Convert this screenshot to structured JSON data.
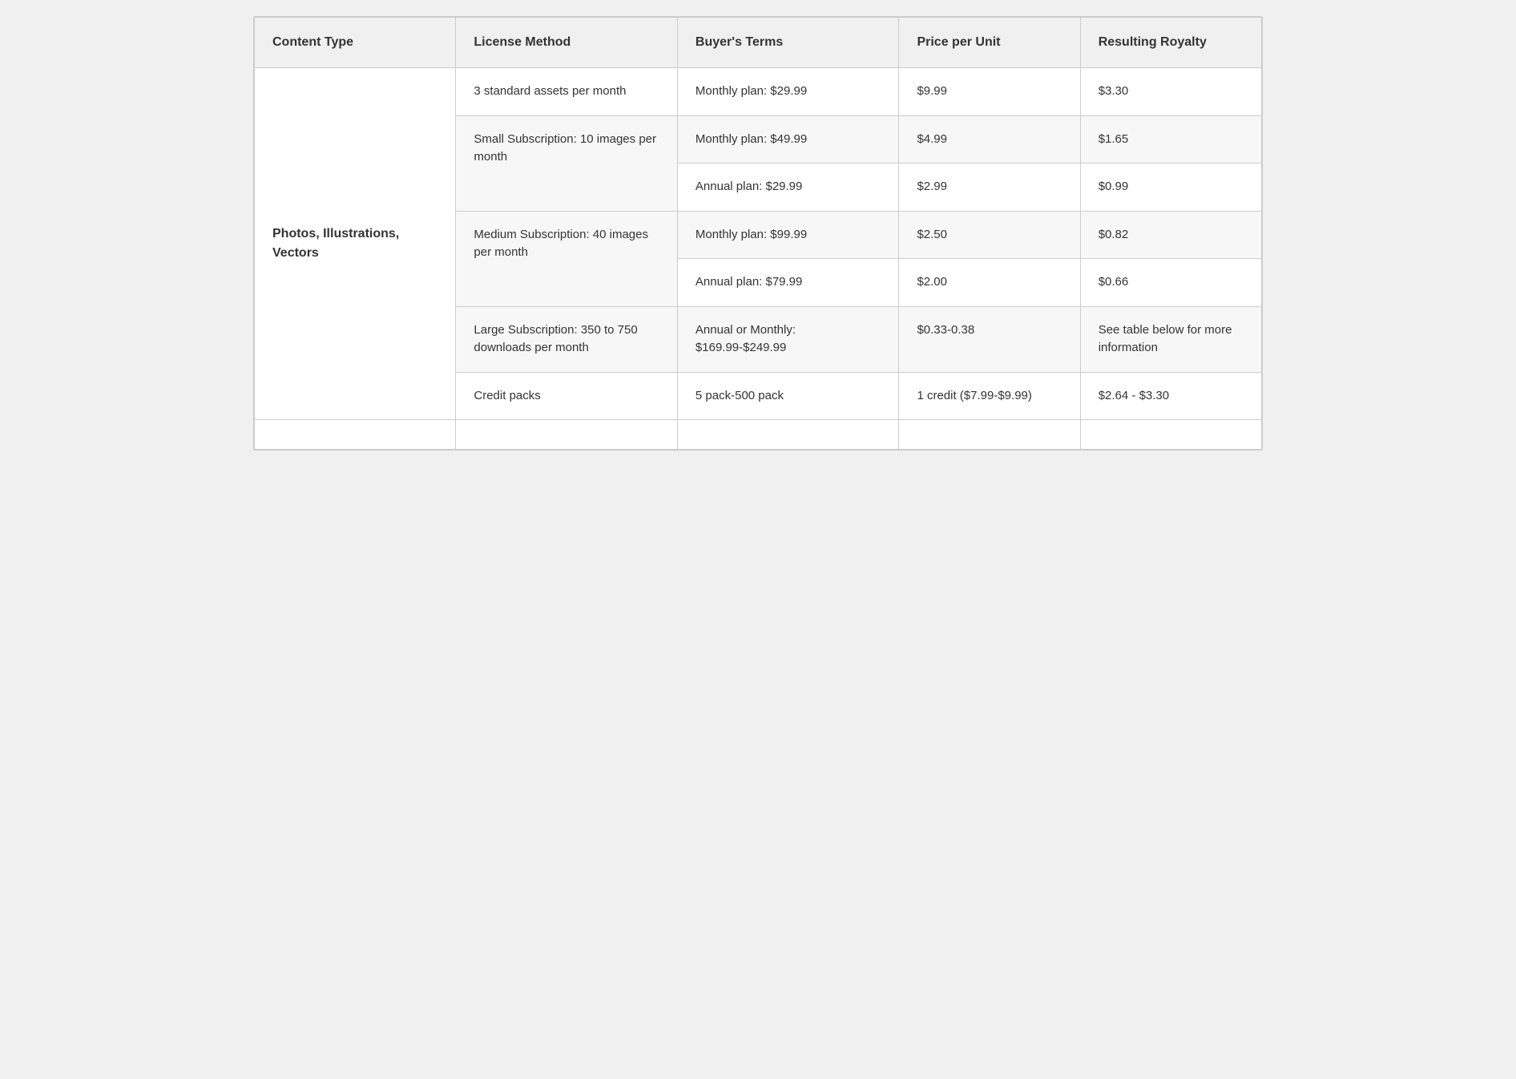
{
  "table": {
    "headers": {
      "content_type": "Content Type",
      "license_method": "License Method",
      "buyers_terms": "Buyer's Terms",
      "price_per_unit": "Price per Unit",
      "resulting_royalty": "Resulting Royalty"
    },
    "sections": [
      {
        "content_type": "Photos, Illustrations, Vectors",
        "rows": [
          {
            "license_method": "3 standard assets per month",
            "buyers_terms": "Monthly plan: $29.99",
            "price_per_unit": "$9.99",
            "resulting_royalty": "$3.30",
            "license_rowspan": 1,
            "shaded": false
          },
          {
            "license_method": "Small Subscription: 10 images per month",
            "buyers_terms": "Monthly plan: $49.99",
            "price_per_unit": "$4.99",
            "resulting_royalty": "$1.65",
            "license_rowspan": 2,
            "shaded": true
          },
          {
            "license_method": null,
            "buyers_terms": "Annual plan: $29.99",
            "price_per_unit": "$2.99",
            "resulting_royalty": "$0.99",
            "license_rowspan": 0,
            "shaded": false
          },
          {
            "license_method": "Medium Subscription: 40 images per month",
            "buyers_terms": "Monthly plan: $99.99",
            "price_per_unit": "$2.50",
            "resulting_royalty": "$0.82",
            "license_rowspan": 2,
            "shaded": true
          },
          {
            "license_method": null,
            "buyers_terms": "Annual plan: $79.99",
            "price_per_unit": "$2.00",
            "resulting_royalty": "$0.66",
            "license_rowspan": 0,
            "shaded": false
          },
          {
            "license_method": "Large Subscription: 350 to 750 downloads per month",
            "buyers_terms": "Annual or Monthly: $169.99-$249.99",
            "price_per_unit": "$0.33-0.38",
            "resulting_royalty": "See table below for more information",
            "license_rowspan": 1,
            "shaded": true
          },
          {
            "license_method": "Credit packs",
            "buyers_terms": "5 pack-500 pack",
            "price_per_unit": "1 credit ($7.99-$9.99)",
            "resulting_royalty": "$2.64 - $3.30",
            "license_rowspan": 1,
            "shaded": false
          }
        ]
      }
    ]
  }
}
